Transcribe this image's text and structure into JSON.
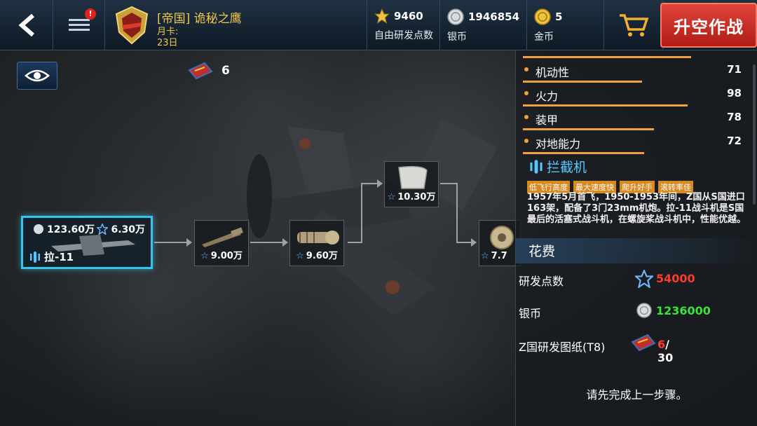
{
  "header": {
    "player_name": "[帝国] 诡秘之鹰",
    "month_card_label": "月卡:",
    "month_card_days": "23日",
    "notification_count": "!",
    "research_points": "9460",
    "research_points_label": "自由研发点数",
    "silver": "1946854",
    "silver_label": "银币",
    "gold": "5",
    "gold_label": "金币",
    "takeoff_button": "升空作战"
  },
  "blueprint": {
    "count": "6"
  },
  "tree": {
    "main_node": {
      "silver_cost": "123.60万",
      "rp_cost": "6.30万",
      "name": "拉-11"
    },
    "nodes": [
      {
        "cost": "9.00万"
      },
      {
        "cost": "9.60万"
      },
      {
        "cost": "10.30万"
      },
      {
        "cost": "7.7"
      }
    ]
  },
  "stats": [
    {
      "name": "机动性",
      "value": "71",
      "level": 0.71
    },
    {
      "name": "火力",
      "value": "98",
      "level": 0.98
    },
    {
      "name": "装甲",
      "value": "78",
      "level": 0.78
    },
    {
      "name": "对地能力",
      "value": "72",
      "level": 0.72
    }
  ],
  "role": "拦截机",
  "tags": [
    "低飞行高度",
    "最大速度快",
    "爬升好手",
    "滚转率佳"
  ],
  "description": "1957年5月首飞，1950-1953年间，Z国从S国进口163架，配备了3门23mm机炮。拉-11战斗机是S国最后的活塞式战斗机，在螺旋桨战斗机中，性能优越。",
  "cost": {
    "title": "花费",
    "rp_label": "研发点数",
    "rp_value": "54000",
    "silver_label": "银币",
    "silver_value": "1236000",
    "blueprint_label": "Z国研发图纸(T8)",
    "blueprint_have": "6",
    "blueprint_need": "/ 30"
  },
  "hint": "请先完成上一步骤。"
}
